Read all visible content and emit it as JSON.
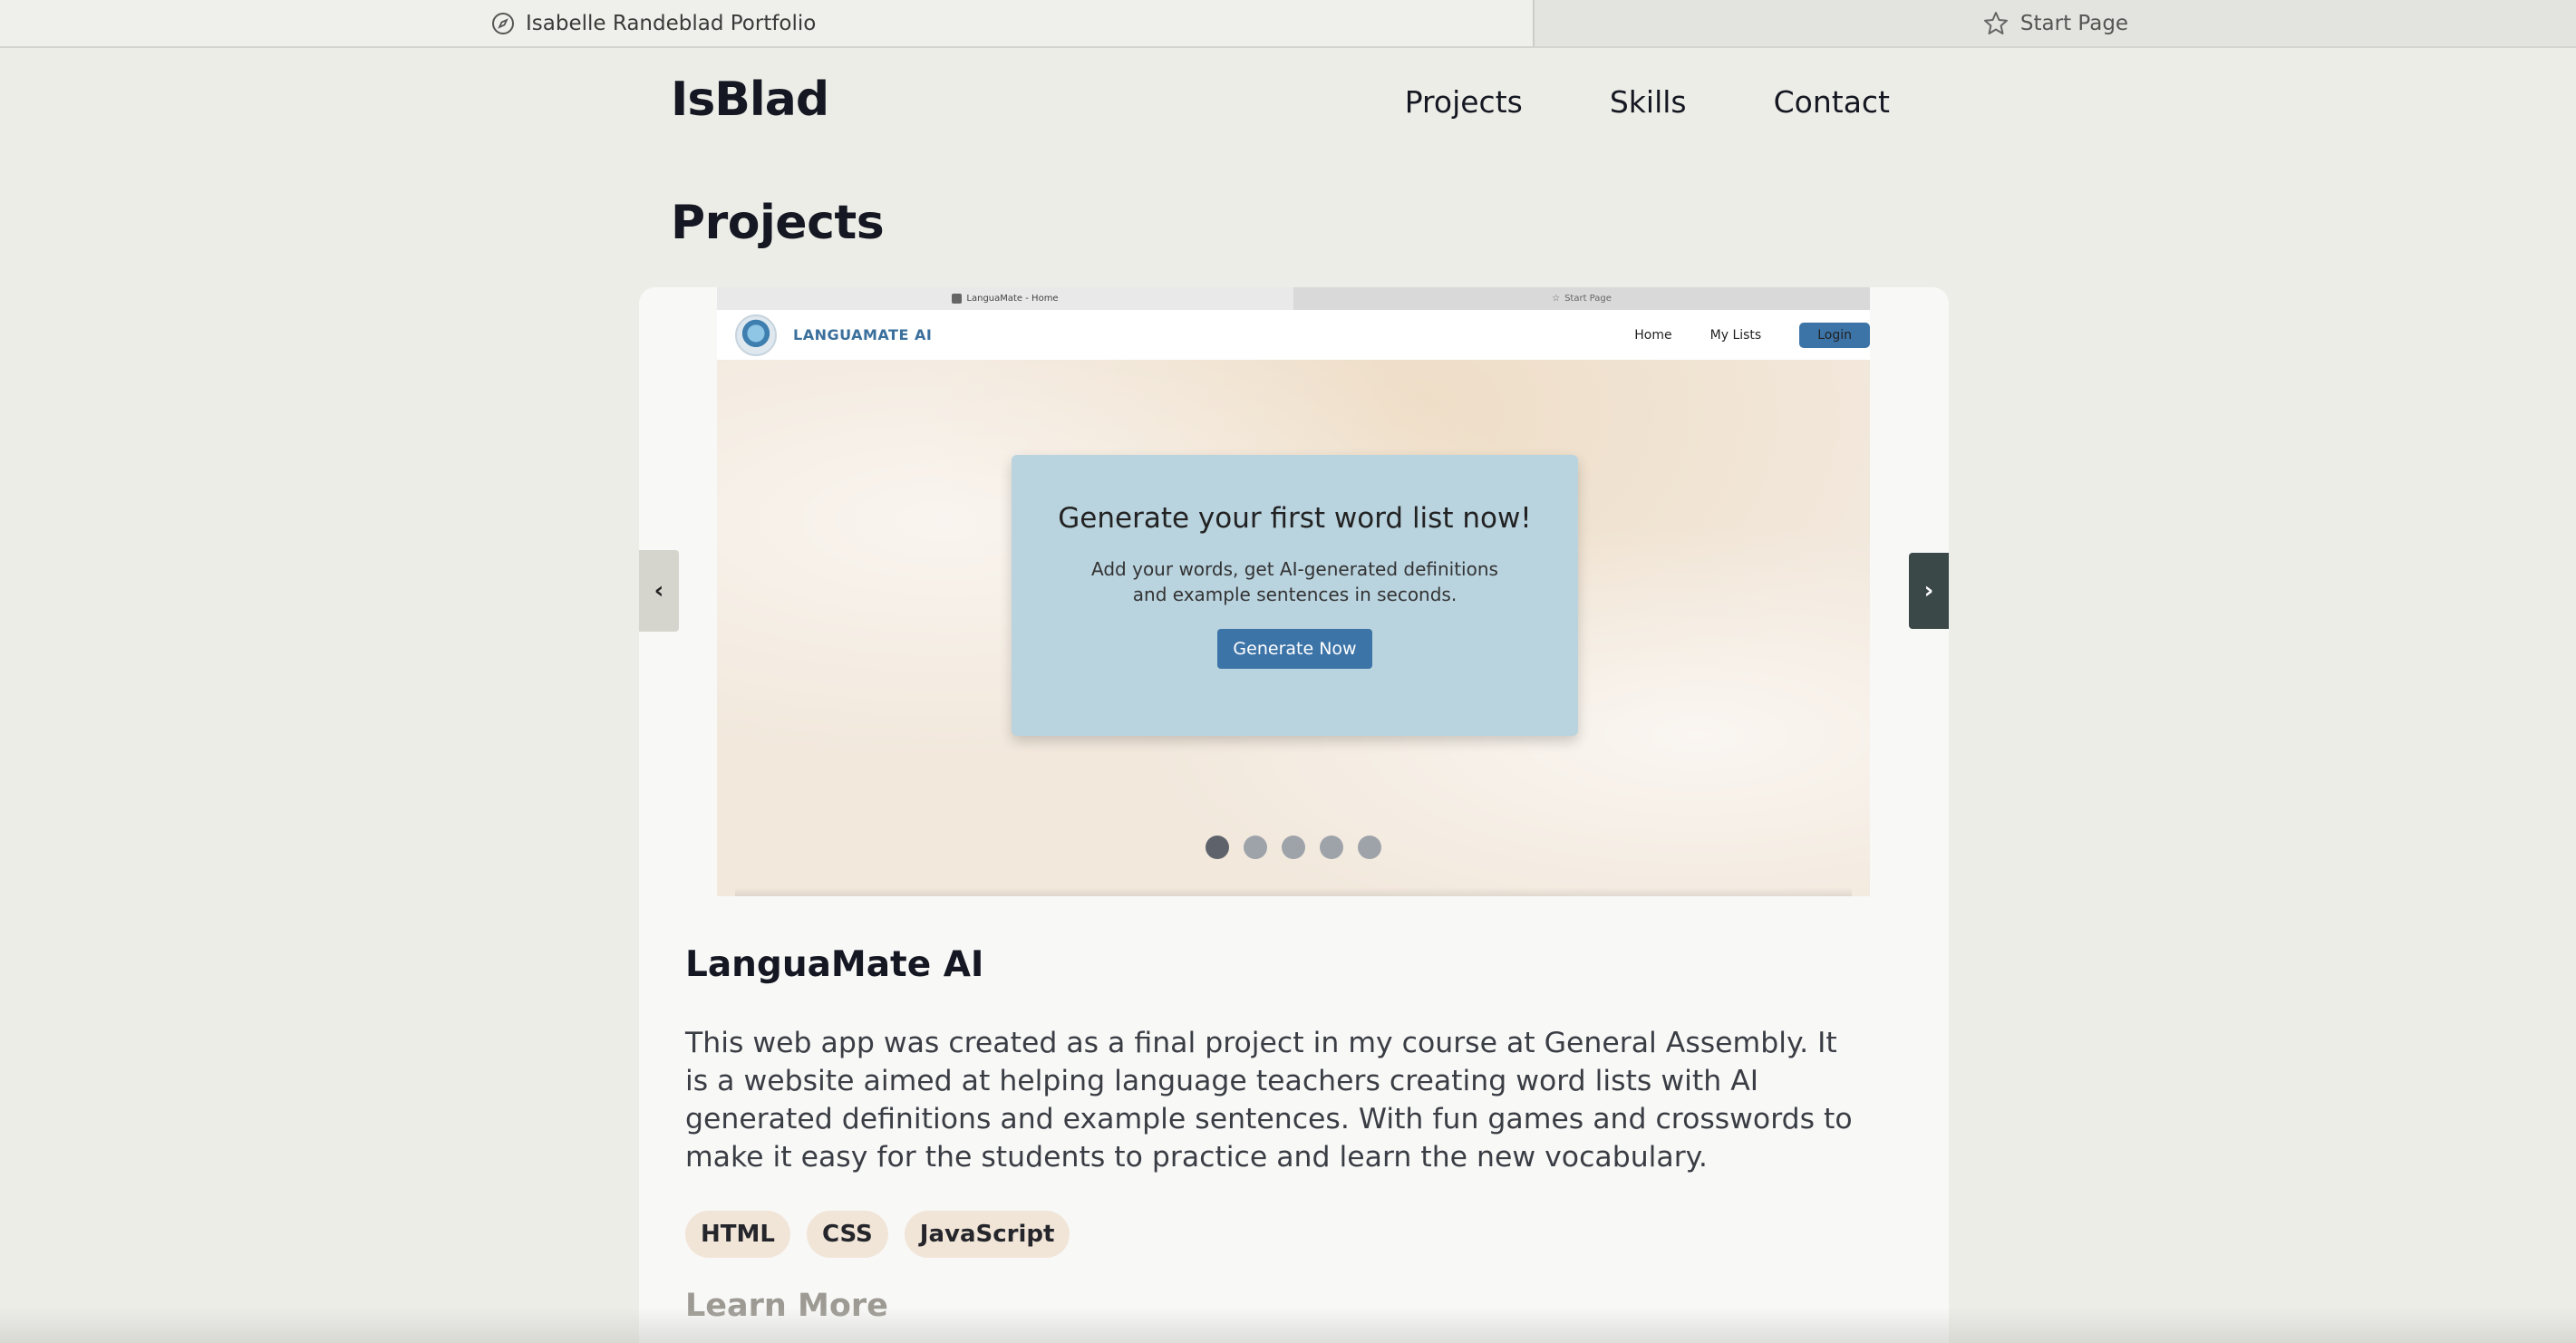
{
  "browser": {
    "tabs": [
      {
        "label": "Isabelle Randeblad Portfolio",
        "icon": "compass-icon",
        "active": true
      },
      {
        "label": "Start Page",
        "icon": "star-icon",
        "active": false
      }
    ]
  },
  "header": {
    "logo": "IsBlad",
    "nav": [
      "Projects",
      "Skills",
      "Contact"
    ]
  },
  "section": {
    "title": "Projects"
  },
  "carousel": {
    "prev_label": "‹",
    "next_label": "›",
    "slide_count": 5,
    "active_slide": 1,
    "screenshot": {
      "tabs": [
        "LanguaMate - Home",
        "Start Page"
      ],
      "brand": "LANGUAMATE AI",
      "nav": [
        "Home",
        "My Lists"
      ],
      "login": "Login",
      "hero_title": "Generate your first word list now!",
      "hero_subtitle": "Add your words, get AI-generated definitions and example sentences in seconds.",
      "hero_button": "Generate Now"
    }
  },
  "project": {
    "title": "LanguaMate AI",
    "description": "This web app was created as a final project in my course at General Assembly. It is a website aimed at helping language teachers creating word lists with AI generated definitions and example sentences. With fun games and crosswords to make it easy for the students to practice and learn the new vocabulary.",
    "tags": [
      "HTML",
      "CSS",
      "JavaScript"
    ],
    "learn_more": "Learn More"
  },
  "colors": {
    "background": "#edede8",
    "card": "#f8f8f7",
    "tag_bg": "#f1e5d8",
    "accent_button": "#3d74a8",
    "next_arrow_bg": "#3a4847"
  }
}
